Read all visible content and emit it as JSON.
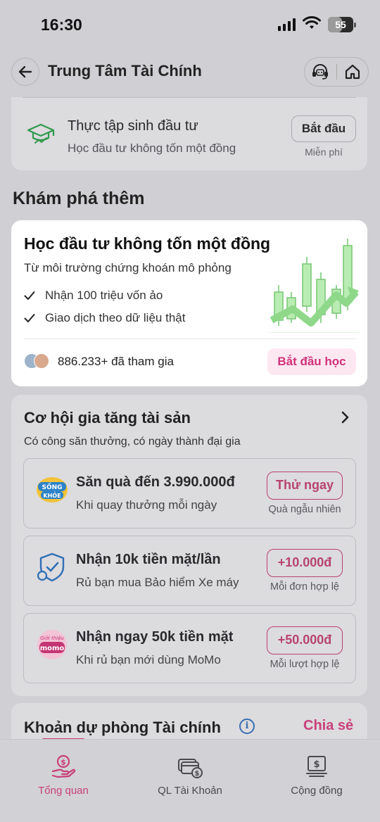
{
  "status_bar": {
    "time": "16:30",
    "battery": "55",
    "battery_level": 0.55
  },
  "header": {
    "title": "Trung Tâm Tài Chính"
  },
  "intern_card": {
    "title": "Thực tập sinh đầu tư",
    "subtitle": "Học đầu tư không tốn một đồng",
    "button": "Bắt đầu",
    "button_note": "Miễn phí"
  },
  "explore": {
    "section_title": "Khám phá thêm",
    "card": {
      "title": "Học đầu tư không tốn một đồng",
      "subtitle": "Từ môi trường chứng khoán mô phỏng",
      "checks": [
        "Nhận 100 triệu vốn ảo",
        "Giao dịch theo dữ liệu thật"
      ],
      "joined": "886.233+ đã tham gia",
      "button": "Bắt đầu học"
    }
  },
  "grow": {
    "title": "Cơ hội gia tăng tài sản",
    "subtitle": "Có công săn thưởng, có ngày thành đại gia",
    "offers": [
      {
        "icon": "song-khoe-logo-icon",
        "icon_text": [
          "SỐNG",
          "KHỎE"
        ],
        "title": "Săn quà đến 3.990.000đ",
        "desc": "Khi quay thưởng mỗi ngày",
        "cta": "Thử ngay",
        "note": "Quà ngẫu nhiên"
      },
      {
        "icon": "shield-check-icon",
        "title": "Nhận 10k tiền mặt/lần",
        "desc": "Rủ bạn mua Bảo hiểm Xe máy",
        "cta": "+10.000đ",
        "note": "Mỗi đơn hợp lệ"
      },
      {
        "icon": "gioi-thieu-momo-icon",
        "icon_text": [
          "Giới thiệu",
          "momo"
        ],
        "title": "Nhận ngay 50k tiền mặt",
        "desc": "Khi rủ bạn mới dùng MoMo",
        "cta": "+50.000đ",
        "note": "Mỗi lượt hợp lệ"
      }
    ]
  },
  "reserve": {
    "title": "Khoản dự phòng Tài chính",
    "info": "i",
    "share": "Chia sẻ"
  },
  "bottom_nav": [
    {
      "label": "Tổng quan",
      "icon": "money-hand-icon",
      "active": true
    },
    {
      "label": "QL Tài Khoản",
      "icon": "cards-dollar-icon",
      "active": false
    },
    {
      "label": "Cộng đồng",
      "icon": "receipt-dollar-icon",
      "active": false
    }
  ],
  "colors": {
    "accent": "#c9407a",
    "background": "#d0cfd3",
    "card": "#dcdbde",
    "white_card": "#ffffff",
    "chart_green": "#8fd88a"
  }
}
